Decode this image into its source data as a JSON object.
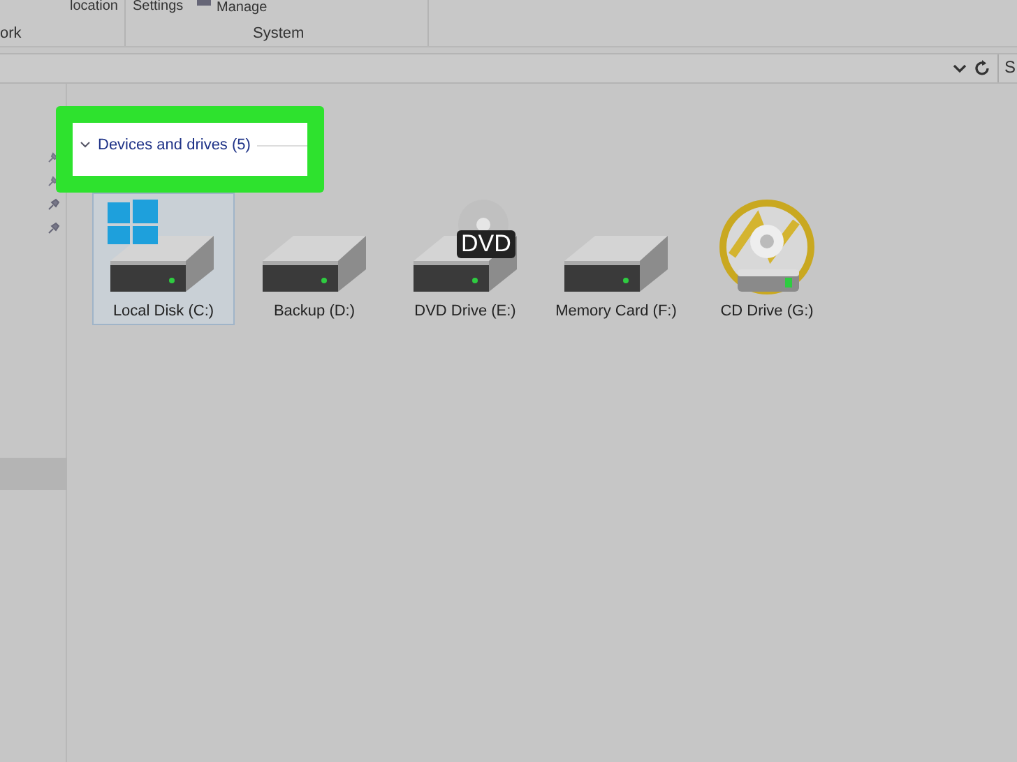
{
  "ribbon": {
    "buttons": [
      {
        "label": "location"
      },
      {
        "label": "Settings"
      },
      {
        "label": "Manage"
      }
    ],
    "groups": [
      {
        "label": "ork"
      },
      {
        "label": "System"
      }
    ]
  },
  "search_box": {
    "placeholder": "S"
  },
  "section": {
    "title": "Devices and drives (5)",
    "expanded": true,
    "highlighted": true
  },
  "drives": [
    {
      "label": "Local Disk (C:)",
      "kind": "system",
      "selected": true
    },
    {
      "label": "Backup (D:)",
      "kind": "hdd",
      "selected": false
    },
    {
      "label": "DVD Drive (E:)",
      "kind": "dvd",
      "badge": "DVD",
      "selected": false
    },
    {
      "label": "Memory Card (F:)",
      "kind": "hdd",
      "selected": false
    },
    {
      "label": "CD Drive (G:)",
      "kind": "cd",
      "selected": false
    }
  ]
}
